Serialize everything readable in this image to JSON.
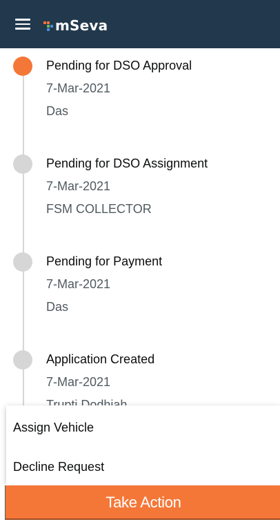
{
  "header": {
    "app_name": "mSeva",
    "menu_icon": "hamburger-icon",
    "logo_icon": "mseva-logo-icon",
    "background_color": "#22394d"
  },
  "timeline": {
    "steps": [
      {
        "title": "Pending for DSO Approval",
        "date": "7-Mar-2021",
        "user": "Das",
        "active": true
      },
      {
        "title": "Pending for DSO Assignment",
        "date": "7-Mar-2021",
        "user": "FSM COLLECTOR",
        "active": false
      },
      {
        "title": "Pending for Payment",
        "date": "7-Mar-2021",
        "user": "Das",
        "active": false
      },
      {
        "title": "Application Created",
        "date": "7-Mar-2021",
        "user": "Trupti Dodhiah",
        "active": false
      }
    ],
    "active_color": "#f47738",
    "inactive_color": "#d6d6d6"
  },
  "action_menu": {
    "items": [
      {
        "label": "Assign Vehicle"
      },
      {
        "label": "Decline Request"
      }
    ]
  },
  "footer": {
    "take_action_label": "Take Action",
    "button_color": "#f47738"
  }
}
